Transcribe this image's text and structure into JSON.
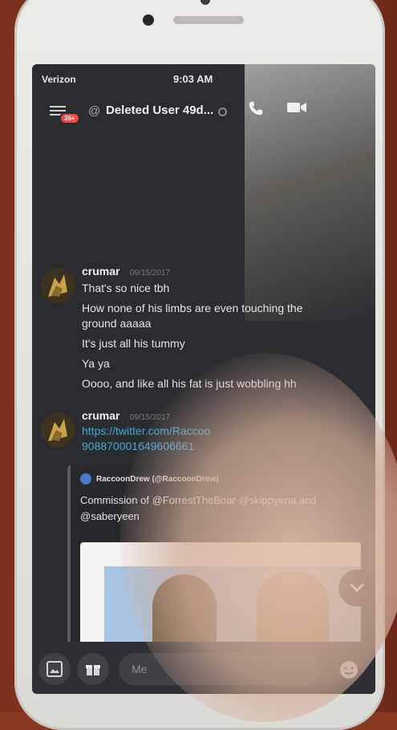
{
  "status_bar": {
    "carrier": "Verizon",
    "time": "9:03 AM"
  },
  "header": {
    "mention_badge": "36+",
    "at_symbol": "@",
    "channel_title": "Deleted User 49d..."
  },
  "messages": [
    {
      "author": "crumar",
      "timestamp": "09/15/2017",
      "lines": [
        "That's so nice tbh",
        "How none of his limbs are even touching the ground aaaaa",
        "It's just all his tummy",
        "Ya ya",
        "Oooo, and like all his fat is just wobbling hh"
      ]
    },
    {
      "author": "crumar",
      "timestamp": "09/15/2017",
      "link_line1": "https://twitter.com/Raccoo",
      "link_line2": "908870001649606661",
      "embed": {
        "author": "RaccoonDrew (@RaccoonDrew)",
        "text": "Commission of @ForrestTheBoar @skippyena and @saberyeen"
      }
    }
  ],
  "composer": {
    "placeholder": "Me"
  },
  "colors": {
    "background": "#2a2c30",
    "link": "#41a8d8",
    "badge": "#f04747"
  },
  "icons": [
    "menu-icon",
    "phone-call-icon",
    "video-icon",
    "image-icon",
    "gift-icon",
    "emoji-icon",
    "chevron-down-icon"
  ]
}
